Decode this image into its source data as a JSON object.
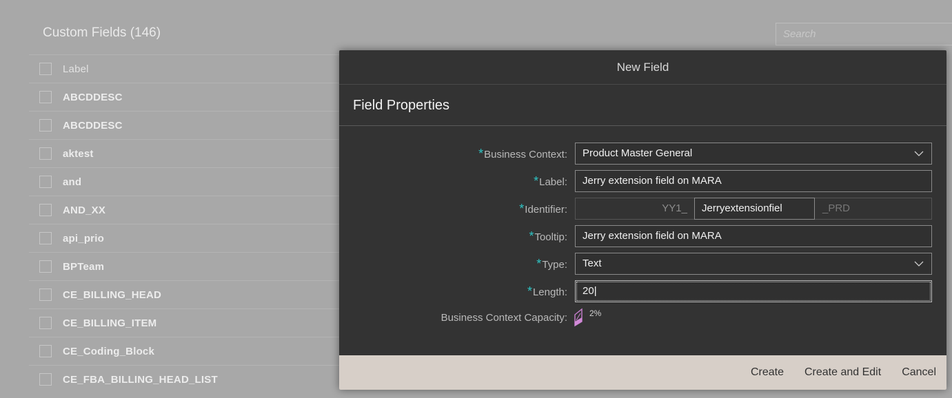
{
  "background": {
    "title": "Custom Fields (146)",
    "search_placeholder": "Search",
    "list_header": "Label",
    "rows": [
      "ABCDDESC",
      "ABCDDESC",
      "aktest",
      "and",
      "AND_XX",
      "api_prio",
      "BPTeam",
      "CE_BILLING_HEAD",
      "CE_BILLING_ITEM",
      "CE_Coding_Block",
      "CE_FBA_BILLING_HEAD_LIST"
    ]
  },
  "dialog": {
    "title": "New Field",
    "section_title": "Field Properties",
    "required_marker": "*",
    "business_context": {
      "label": "Business Context:",
      "value": "Product Master General"
    },
    "label_field": {
      "label": "Label:",
      "value": "Jerry extension field on MARA"
    },
    "identifier": {
      "label": "Identifier:",
      "prefix": "YY1_",
      "value": "Jerryextensionfiel",
      "suffix": "_PRD"
    },
    "tooltip": {
      "label": "Tooltip:",
      "value": "Jerry extension field on MARA"
    },
    "type": {
      "label": "Type:",
      "value": "Text"
    },
    "length": {
      "label": "Length:",
      "value": "20"
    },
    "capacity": {
      "label": "Business Context Capacity:",
      "value": "2%",
      "fraction": 0.02
    },
    "buttons": {
      "create": "Create",
      "create_and_edit": "Create and Edit",
      "cancel": "Cancel"
    }
  },
  "colors": {
    "accent_required": "#2ec4c4",
    "dialog_bg": "#333333",
    "footer_bg": "#d7cfc8"
  }
}
